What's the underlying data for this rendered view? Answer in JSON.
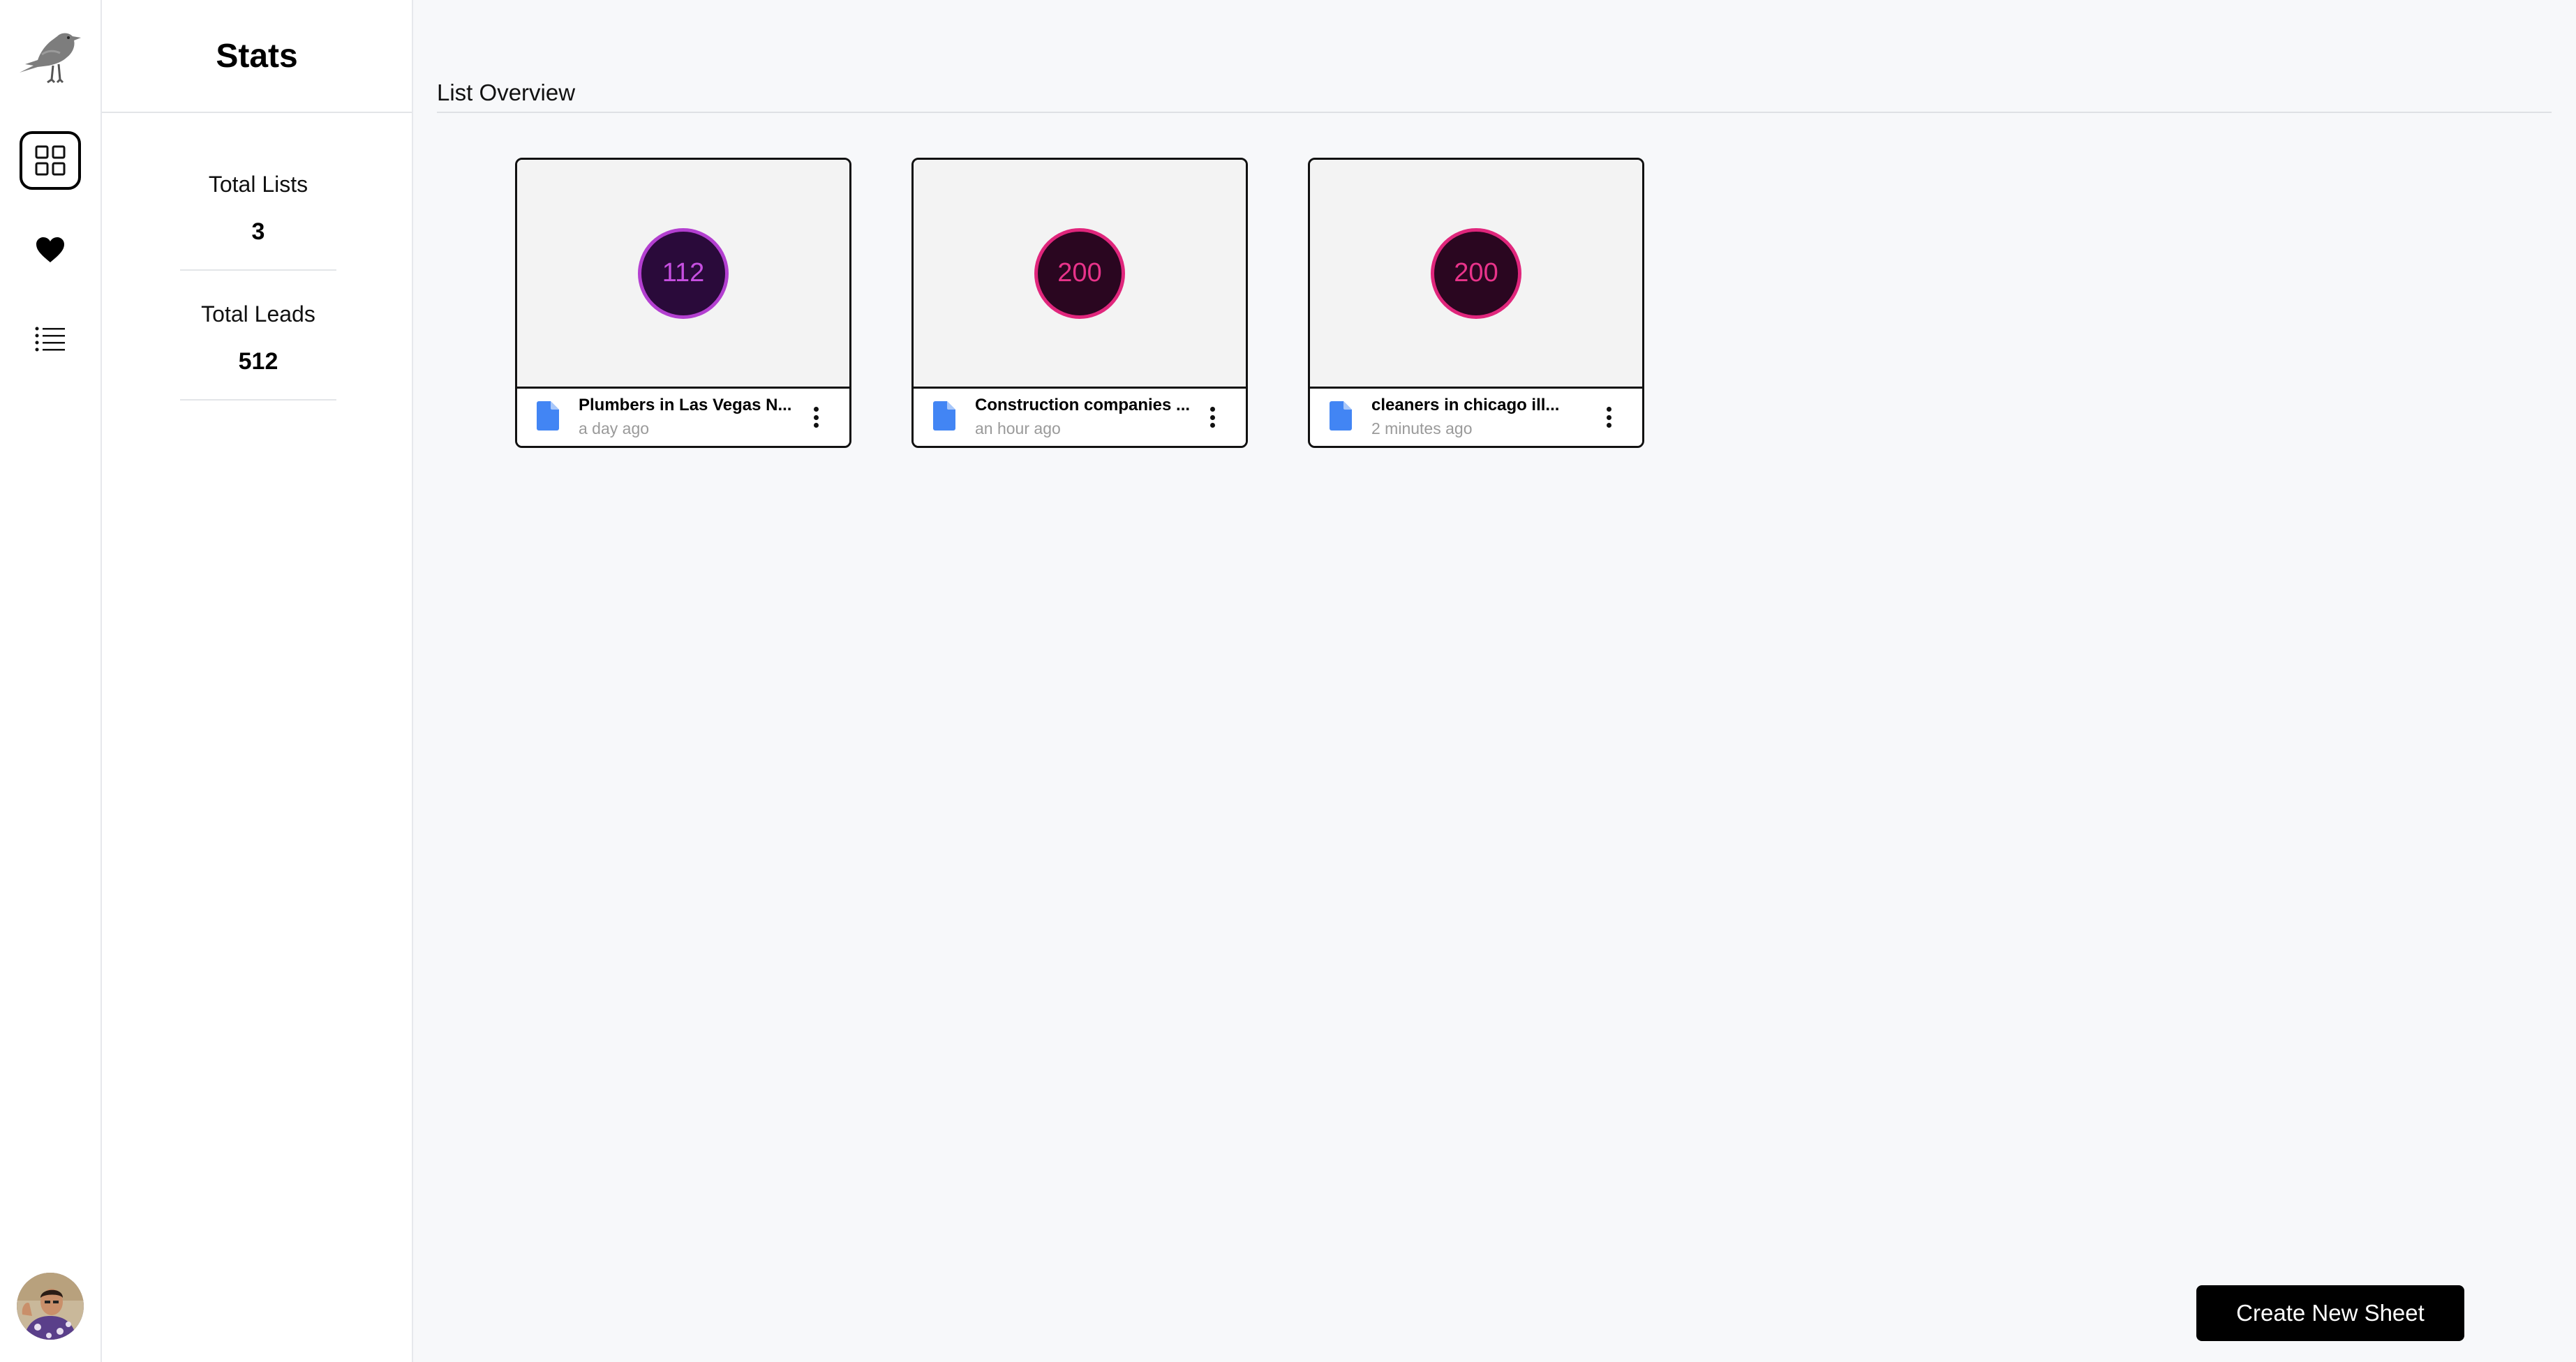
{
  "rail": {
    "icons": [
      "crow-logo-icon",
      "grid-icon",
      "heart-icon",
      "list-icon",
      "user-avatar"
    ],
    "active": "grid-icon"
  },
  "stats": {
    "title": "Stats",
    "items": [
      {
        "label": "Total Lists",
        "value": "3"
      },
      {
        "label": "Total Leads",
        "value": "512"
      }
    ]
  },
  "main": {
    "section_title": "List Overview",
    "cards": [
      {
        "count": "112",
        "name": "Plumbers in Las Vegas N...",
        "time": "a day ago",
        "circle_bg": "#2a0a3a",
        "circle_border": "#b33fd0",
        "circle_text": "#c64fe0"
      },
      {
        "count": "200",
        "name": "Construction companies ...",
        "time": "an hour ago",
        "circle_bg": "#2a0620",
        "circle_border": "#e0267c",
        "circle_text": "#e8338a"
      },
      {
        "count": "200",
        "name": "cleaners in chicago ill...",
        "time": "2 minutes ago",
        "circle_bg": "#2a0620",
        "circle_border": "#e0267c",
        "circle_text": "#e8338a"
      }
    ],
    "create_button": "Create New Sheet"
  },
  "colors": {
    "doc_icon": "#4285f4",
    "background": "#f7f8fa"
  }
}
